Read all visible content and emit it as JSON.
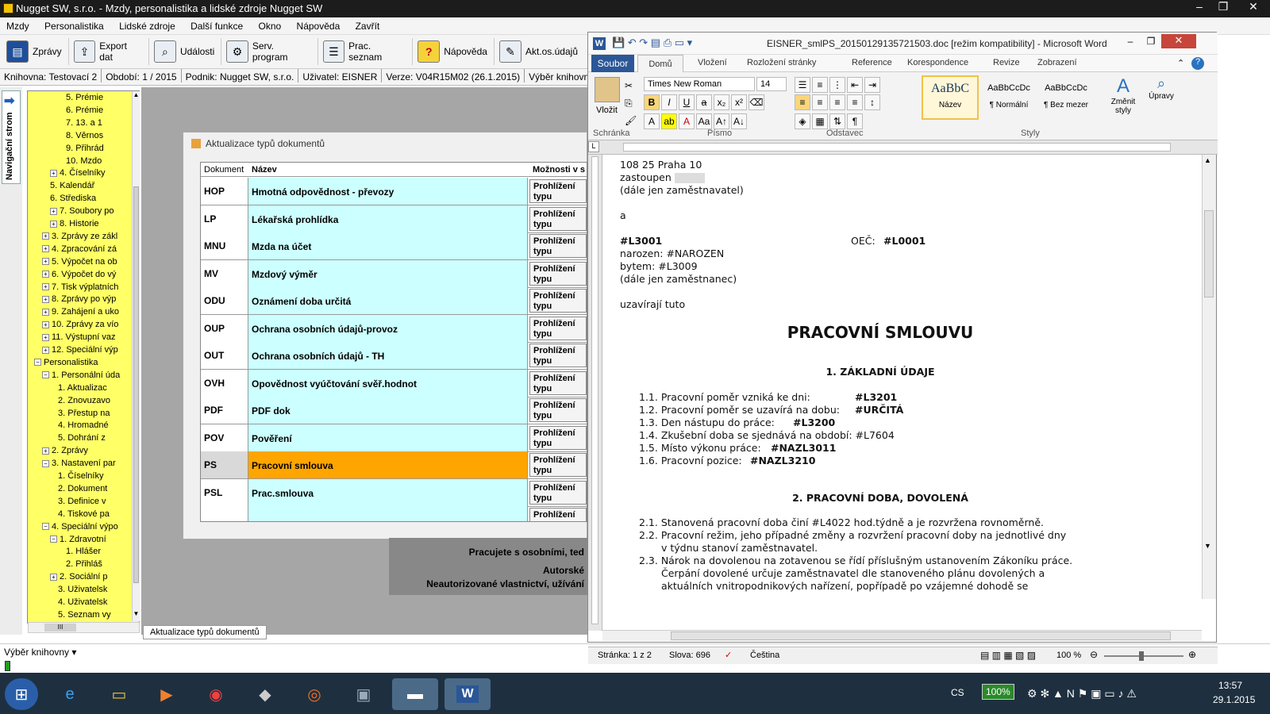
{
  "app": {
    "title": "Nugget SW, s.r.o. - Mzdy, personalistika a lidské zdroje Nugget SW"
  },
  "window_controls": [
    "–",
    "❐",
    "✕"
  ],
  "menu": [
    "Mzdy",
    "Personalistika",
    "Lidské zdroje",
    "Další funkce",
    "Okno",
    "Nápověda",
    "Zavřít"
  ],
  "toolbar": [
    {
      "label": "Zprávy",
      "icon": "printer-icon"
    },
    {
      "label": "Export dat",
      "icon": "export-icon"
    },
    {
      "label": "Události",
      "icon": "magnifier-icon"
    },
    {
      "label": "Serv. program",
      "icon": "gear-icon"
    },
    {
      "label": "Prac. seznam",
      "icon": "worker-list-icon"
    },
    {
      "label": "Nápověda",
      "icon": "help-icon"
    },
    {
      "label": "Akt.os.údajů",
      "icon": "edit-icon"
    }
  ],
  "infobar": [
    "Knihovna: Testovací 2",
    "Období: 1 / 2015",
    "Podnik: Nugget SW, s.r.o.",
    "Uživatel: EISNER",
    "Verze: V04R15M02 (26.1.2015)",
    "Výběr knihovny ▾"
  ],
  "nav": {
    "label": "Navigační strom"
  },
  "tree": [
    {
      "label": "5. Prémie",
      "indent": 5,
      "exp": ""
    },
    {
      "label": "6. Prémie",
      "indent": 5,
      "exp": ""
    },
    {
      "label": "7. 13. a 1",
      "indent": 5,
      "exp": ""
    },
    {
      "label": "8. Věrnos",
      "indent": 5,
      "exp": ""
    },
    {
      "label": "9. Přihrád",
      "indent": 5,
      "exp": ""
    },
    {
      "label": "10. Mzdo",
      "indent": 5,
      "exp": ""
    },
    {
      "label": "4. Číselníky",
      "indent": 3,
      "exp": "+"
    },
    {
      "label": "5. Kalendář",
      "indent": 3,
      "exp": ""
    },
    {
      "label": "6. Střediska",
      "indent": 3,
      "exp": ""
    },
    {
      "label": "7. Soubory po",
      "indent": 3,
      "exp": "+"
    },
    {
      "label": "8. Historie",
      "indent": 3,
      "exp": "+"
    },
    {
      "label": "3. Zprávy ze zákl",
      "indent": 2,
      "exp": "+"
    },
    {
      "label": "4. Zpracování zá",
      "indent": 2,
      "exp": "+"
    },
    {
      "label": "5. Výpočet na ob",
      "indent": 2,
      "exp": "+"
    },
    {
      "label": "6. Výpočet do vý",
      "indent": 2,
      "exp": "+"
    },
    {
      "label": "7. Tisk výplatních",
      "indent": 2,
      "exp": "+"
    },
    {
      "label": "8. Zprávy po výp",
      "indent": 2,
      "exp": "+"
    },
    {
      "label": "9. Zahájení a uko",
      "indent": 2,
      "exp": "+"
    },
    {
      "label": "10. Zprávy za vío",
      "indent": 2,
      "exp": "+"
    },
    {
      "label": "11. Výstupní vaz",
      "indent": 2,
      "exp": "+"
    },
    {
      "label": "12. Speciální výp",
      "indent": 2,
      "exp": "+"
    },
    {
      "label": "Personalistika",
      "indent": 1,
      "exp": "−"
    },
    {
      "label": "1. Personální úda",
      "indent": 2,
      "exp": "−"
    },
    {
      "label": "1. Aktualizac",
      "indent": 4,
      "exp": ""
    },
    {
      "label": "2. Znovuzavo",
      "indent": 4,
      "exp": ""
    },
    {
      "label": "3. Přestup na",
      "indent": 4,
      "exp": ""
    },
    {
      "label": "4. Hromadné",
      "indent": 4,
      "exp": ""
    },
    {
      "label": "5. Dohrání z",
      "indent": 4,
      "exp": ""
    },
    {
      "label": "2. Zprávy",
      "indent": 2,
      "exp": "+"
    },
    {
      "label": "3. Nastavení par",
      "indent": 2,
      "exp": "−"
    },
    {
      "label": "1. Číselníky",
      "indent": 4,
      "exp": ""
    },
    {
      "label": "2. Dokument",
      "indent": 4,
      "exp": ""
    },
    {
      "label": "3. Definice v",
      "indent": 4,
      "exp": ""
    },
    {
      "label": "4. Tiskové pa",
      "indent": 4,
      "exp": ""
    },
    {
      "label": "4. Speciální výpo",
      "indent": 2,
      "exp": "−"
    },
    {
      "label": "1. Zdravotní",
      "indent": 3,
      "exp": "−"
    },
    {
      "label": "1. Hlášer",
      "indent": 5,
      "exp": ""
    },
    {
      "label": "2. Přihláš",
      "indent": 5,
      "exp": ""
    },
    {
      "label": "2. Sociální p",
      "indent": 3,
      "exp": "+"
    },
    {
      "label": "3. Uživatelsk",
      "indent": 4,
      "exp": ""
    },
    {
      "label": "4. Uživatelsk",
      "indent": 4,
      "exp": ""
    },
    {
      "label": "5. Seznam vy",
      "indent": 4,
      "exp": ""
    }
  ],
  "tree_hscroll": "III",
  "dialog": {
    "title": "Aktualizace typů dokumentů",
    "headers": [
      "Dokument",
      "Název",
      "Možnosti v s"
    ],
    "rows": [
      {
        "code": "HOP",
        "name": "Hmotná odpovědnost - převozy",
        "btn": "Prohlížení typu"
      },
      {
        "code": "LP",
        "name": "Lékařská prohlídka",
        "btn": "Prohlížení typu"
      },
      {
        "code": "MNU",
        "name": "Mzda na účet",
        "btn": "Prohlížení typu"
      },
      {
        "code": "MV",
        "name": "Mzdový výměr",
        "btn": "Prohlížení typu"
      },
      {
        "code": "ODU",
        "name": "Oznámení doba určitá",
        "btn": "Prohlížení typu"
      },
      {
        "code": "OUP",
        "name": "Ochrana osobních údajů-provoz",
        "btn": "Prohlížení typu"
      },
      {
        "code": "OUT",
        "name": "Ochrana osobních údajů - TH",
        "btn": "Prohlížení typu"
      },
      {
        "code": "OVH",
        "name": "Opovědnost vyúčtování svěř.hodnot",
        "btn": "Prohlížení typu"
      },
      {
        "code": "PDF",
        "name": "PDF dok",
        "btn": "Prohlížení typu"
      },
      {
        "code": "POV",
        "name": "Pověření",
        "btn": "Prohlížení typu"
      },
      {
        "code": "PS",
        "name": "Pracovní smlouva",
        "btn": "Prohlížení typu",
        "selected": true
      },
      {
        "code": "PSL",
        "name": "Prac.smlouva",
        "btn": "Prohlížení typu"
      },
      {
        "code": "",
        "name": "",
        "btn": "Prohlížení"
      }
    ]
  },
  "notice": {
    "line1": "Pracujete s osobními, ted",
    "line2": "Autorské",
    "line3": "Neautorizované vlastnictví, užívání"
  },
  "tab": {
    "label": "Aktualizace typů dokumentů"
  },
  "status": {
    "library": "Výběr knihovny ▾"
  },
  "word": {
    "title": "EISNER_smlPS_20150129135721503.doc [režim kompatibility] - Microsoft Word",
    "tabs": [
      "Soubor",
      "Domů",
      "Vložení",
      "Rozložení stránky",
      "Reference",
      "Korespondence",
      "Revize",
      "Zobrazení"
    ],
    "font": "Times New Roman",
    "size": "14",
    "groups": [
      "Schránka",
      "Písmo",
      "Odstavec",
      "Styly"
    ],
    "paste": "Vložit",
    "styles": [
      {
        "preview": "AaBbC",
        "name": "Název"
      },
      {
        "preview": "AaBbCcDc",
        "name": "¶ Normální"
      },
      {
        "preview": "AaBbCcDc",
        "name": "¶ Bez mezer"
      }
    ],
    "change_styles": "Změnit styly",
    "edit": "Úpravy",
    "doc": {
      "l1": "108 25 Praha 10",
      "l2": "zastoupen",
      "l3": "(dále jen zaměstnavatel)",
      "l4": "a",
      "l5a": "#L3001",
      "l5b": "OEČ:",
      "l5c": "#L0001",
      "l6": "narozen: #NAROZEN",
      "l7": "bytem:   #L3009",
      "l8": "(dále jen zaměstnanec)",
      "l9": "uzavírají tuto",
      "heading": "PRACOVNÍ SMLOUVU",
      "s1": "1.  ZÁKLADNÍ ÚDAJE",
      "i11": "1.1. Pracovní poměr vzniká ke dni:",
      "i11v": "#L3201",
      "i12": "1.2. Pracovní poměr se uzavírá na dobu:",
      "i12v": "#URČITÁ",
      "i13": "1.3. Den nástupu do práce:",
      "i13v": "#L3200",
      "i14": "1.4. Zkušební doba se sjednává na období: #L7604",
      "i15": "1.5. Místo výkonu práce:",
      "i15v": "#NAZL3011",
      "i16": "1.6. Pracovní pozice:",
      "i16v": "#NAZL3210",
      "s2": "2.  PRACOVNÍ DOBA, DOVOLENÁ",
      "i21": "2.1. Stanovená pracovní doba činí #L4022 hod.týdně a je rozvržena rovnoměrně.",
      "i22a": "2.2. Pracovní režim, jeho případné změny a rozvržení pracovní doby na jednotlivé dny",
      "i22b": "v týdnu stanoví zaměstnavatel.",
      "i23a": "2.3. Nárok na dovolenou na zotavenou se řídí příslušným ustanovením Zákoníku práce.",
      "i23b": "Čerpání dovolené určuje zaměstnavatel dle stanoveného plánu dovolených a",
      "i23c": "aktuálních vnitropodnikových nařízení, popřípadě po vzájemné dohodě se"
    },
    "status": {
      "page": "Stránka: 1 z 2",
      "words": "Slova: 696",
      "lang": "Čeština",
      "zoom": "100 %"
    }
  },
  "taskbar": {
    "lang": "CS",
    "battery": "100%",
    "time": "13:57",
    "date": "29.1.2015"
  }
}
